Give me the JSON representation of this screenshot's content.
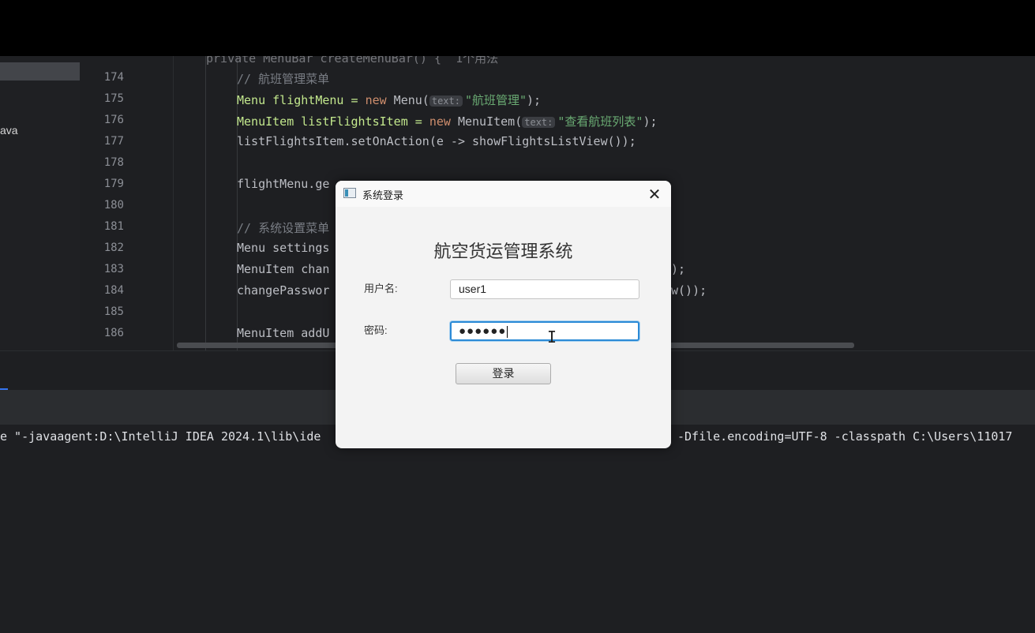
{
  "sidebar": {
    "file_label": "ava"
  },
  "editor": {
    "partial_line": "private MenuBar createMenuBar() {  1个用法",
    "line_numbers": [
      "174",
      "175",
      "176",
      "177",
      "178",
      "179",
      "180",
      "181",
      "182",
      "183",
      "184",
      "185",
      "186"
    ],
    "lines": {
      "l174": "// 航班管理菜单",
      "l175_a": "Menu flightMenu = ",
      "l175_kw": "new",
      "l175_b": " Menu(",
      "l175_hint": "text:",
      "l175_str": "\"航班管理\"",
      "l175_c": ");",
      "l176_a": "MenuItem listFlightsItem = ",
      "l176_kw": "new",
      "l176_b": " MenuItem(",
      "l176_hint": "text:",
      "l176_str": "\"查看航班列表\"",
      "l176_c": ");",
      "l177": "listFlightsItem.setOnAction(e -> showFlightsListView());",
      "l179": "flightMenu.ge",
      "l181": "// 系统设置菜单",
      "l182": "Menu settings",
      "l183": "MenuItem chan",
      "l183_tail": ");",
      "l184": "changePasswor",
      "l184_tail": "w());",
      "l186": "MenuItem addU"
    }
  },
  "console": {
    "left_text": "e \"-javaagent:D:\\IntelliJ IDEA 2024.1\\lib\\ide",
    "right_text": "-Dfile.encoding=UTF-8 -classpath C:\\Users\\11017"
  },
  "dialog": {
    "title": "系统登录",
    "close_glyph": "✕",
    "heading": "航空货运管理系统",
    "username_label": "用户名:",
    "username_value": "user1",
    "password_label": "密码:",
    "password_masked": "●●●●●●",
    "login_button": "登录"
  }
}
